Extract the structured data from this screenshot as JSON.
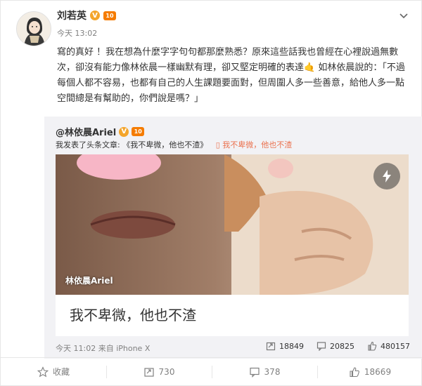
{
  "post": {
    "author": "刘若英",
    "vip_badge": "V",
    "vip_level": "10",
    "time": "今天 13:02",
    "text": "寫的真好 ！我在想為什麼字字句句都那麼熟悉？原來這些話我也曾經在心裡說過無數次，卻沒有能力像林依晨一樣幽默有理，卻又堅定明確的表達🤙 如林依晨說的：「不過每個人都不容易，也都有自己的人生課題要面對，但周圍人多一些善意，給他人多一點空間總是有幫助的，你們說是嗎？」"
  },
  "repost": {
    "author": "@林依晨Ariel",
    "vip_badge": "V",
    "vip_level": "10",
    "line_prefix": "我发表了头条文章:",
    "article_link": "《我不卑微，他也不渣》",
    "article_icon_text": "我不卑微，他也不渣",
    "card_watermark": "林依晨Ariel",
    "card_title": "我不卑微，他也不渣",
    "meta": "今天 11:02 来自 iPhone X",
    "stats": {
      "reposts": "18849",
      "comments": "20825",
      "likes": "480157"
    }
  },
  "toolbar": {
    "favorite": "收藏",
    "repost": "730",
    "comment": "378",
    "like": "18669"
  },
  "colors": {
    "accent": "#eb7350",
    "gold": "#f4a52b",
    "repost_bg": "#f2f2f5"
  }
}
